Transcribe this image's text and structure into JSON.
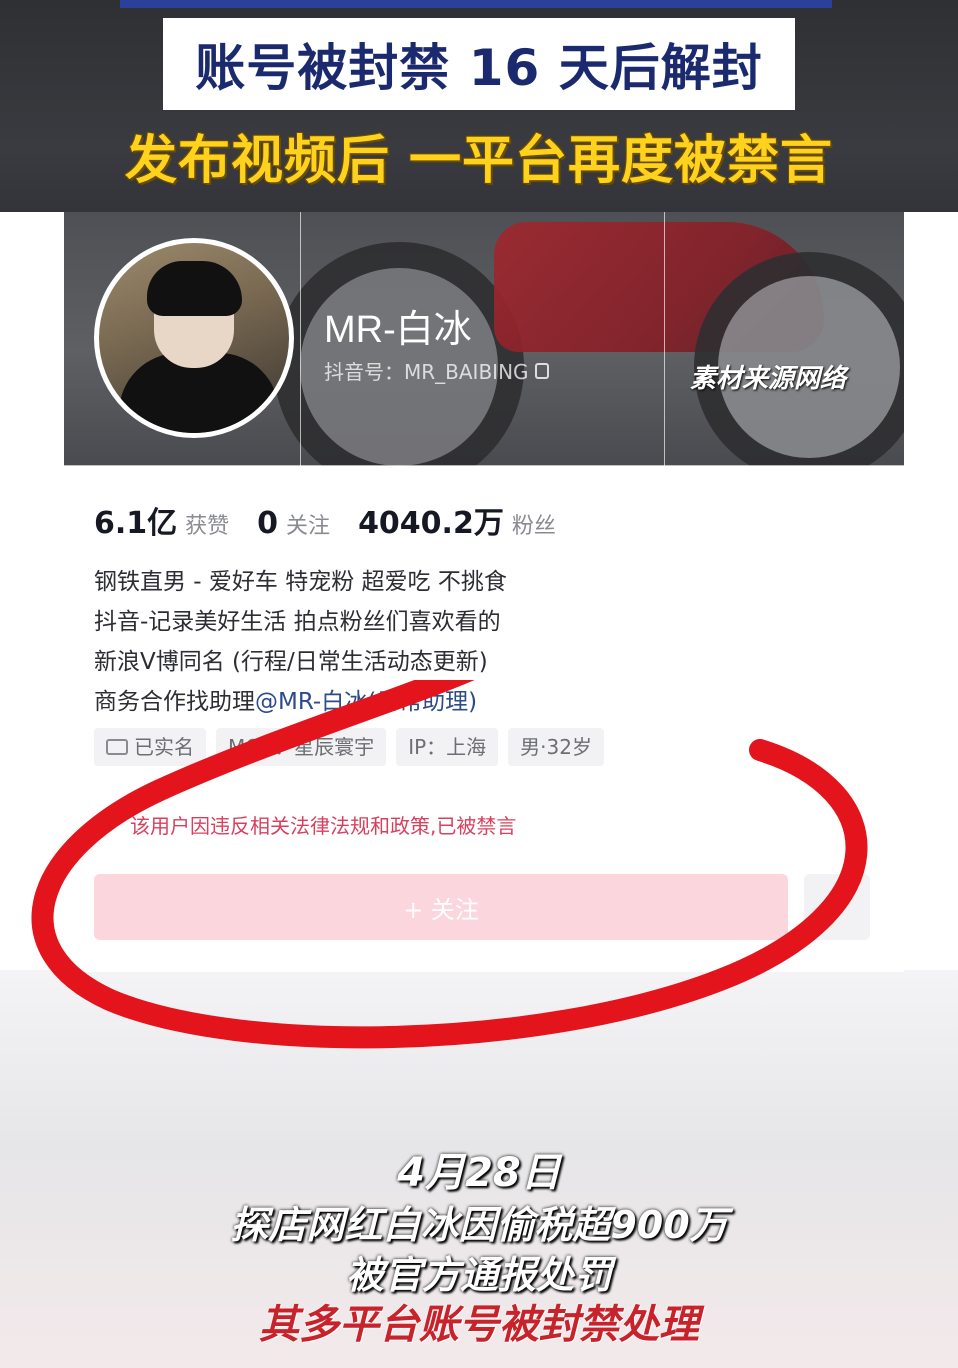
{
  "headline": "账号被封禁 16 天后解封",
  "subheadline": "发布视频后 一平台再度被禁言",
  "profile": {
    "nickname": "MR-白冰",
    "douyin_id": "抖音号：MR_BAIBING",
    "source_label": "素材来源网络",
    "stats": [
      {
        "value": "6.1亿",
        "label": "获赞"
      },
      {
        "value": "0",
        "label": "关注"
      },
      {
        "value": "4040.2万",
        "label": "粉丝"
      }
    ],
    "bio": [
      "钢铁直男 - 爱好车 特宠粉 超爱吃 不挑食",
      "抖音-记录美好生活 拍点粉丝们喜欢看的",
      "新浪V博同名 (行程/日常生活动态更新)"
    ],
    "bio_last_prefix": "商务合作找助理",
    "bio_last_mention": "@MR-白冰(日常助理)",
    "tags": [
      "已实名",
      "MCN：星辰寰宇",
      "IP：上海",
      "男·32岁"
    ],
    "ban_notice": "该用户因违反相关法律法规和政策,已被禁言",
    "follow_button": "+ 关注"
  },
  "captions": {
    "date": "4月28日",
    "line1": "探店网红白冰因偷税超900万",
    "line2": "被官方通报处罚",
    "line3": "其多平台账号被封禁处理"
  },
  "colors": {
    "headline_text": "#1b2a6e",
    "subheadline_text": "#ffd21e",
    "ban_notice": "#d9405e",
    "follow_button_bg": "#fbd7dd",
    "annotation_red": "#e3141c",
    "caption_red": "#c8222b"
  },
  "icons": [
    "copy-icon",
    "id-card-icon",
    "chevron-down-icon"
  ]
}
